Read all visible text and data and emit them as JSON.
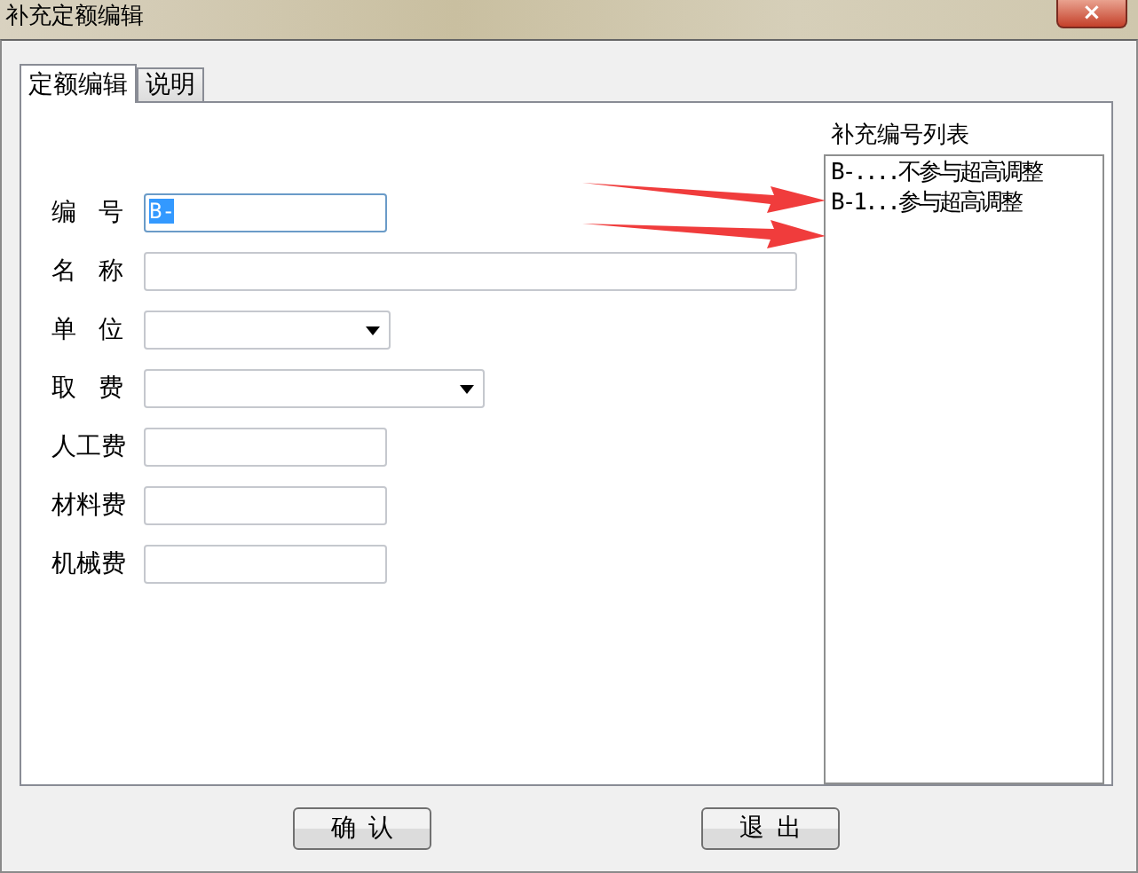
{
  "window": {
    "title": "补充定额编辑",
    "close": "×"
  },
  "tabs": [
    {
      "label": "定额编辑",
      "selected": true
    },
    {
      "label": "说明",
      "selected": false
    }
  ],
  "fields": [
    {
      "label": "编 号",
      "kind": "text",
      "value": "B-",
      "focused": true
    },
    {
      "label": "名 称",
      "kind": "text",
      "focused": false
    },
    {
      "label": "单 位",
      "kind": "select",
      "focused": false
    },
    {
      "label": "取 费",
      "kind": "select",
      "focused": false
    },
    {
      "label": "人工费",
      "kind": "text",
      "focused": false
    },
    {
      "label": "材料费",
      "kind": "text",
      "focused": false
    },
    {
      "label": "机械费",
      "kind": "text",
      "focused": false
    }
  ],
  "list": {
    "caption": "补充编号列表",
    "items": [
      "B-....不参与超高调整",
      "B-1...参与超高调整"
    ]
  },
  "buttons": [
    "确 认",
    "退 出"
  ]
}
